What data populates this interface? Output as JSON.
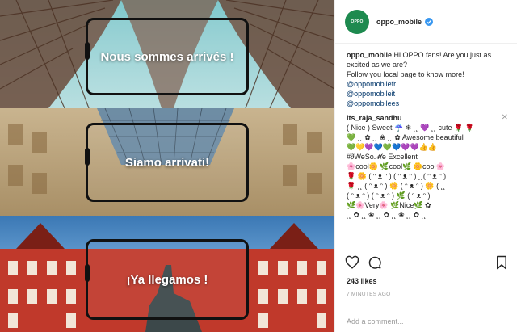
{
  "photo": {
    "panels": [
      {
        "caption": "Nous sommes arrivés !"
      },
      {
        "caption": "Siamo arrivati!"
      },
      {
        "caption": "¡Ya llegamos !"
      }
    ]
  },
  "post": {
    "avatar_text": "OPPO",
    "username": "oppo_mobile",
    "caption_user": "oppo_mobile",
    "caption_text": "Hi OPPO fans! Are you just as excited as we are?",
    "caption_line2": "Follow you local page to know more!",
    "mentions": [
      "@oppomobilefr",
      "@oppomobileit",
      "@oppomobilees"
    ],
    "comment_user": "its_raja_sandhu",
    "comment_lines": [
      "( Nice ) Sweet ☔ ❄ ˛˛ 💜 ˛˛ cute 🌹 🌹",
      "💚 ˛˛ ✿ ˛˛ ❀ ˛˛ ✿ Awesome beautiful",
      "💚💛💜💙💚💙💜💜👍👍",
      "#∂WeSo𝓜e Excellent",
      "🌸cool🌼 🌿cool🌿 🌼cool🌸",
      "🌹 🌼 ( ᵔ ᴥ ᵔ ) ( ᵔ ᴥ ᵔ ) ˛˛( ᵔ ᴥ ᵔ )",
      "🌹 ˛˛ ( ᵔ ᴥ ᵔ ) 🌼 ( ᵔ ᴥ ᵔ ) 🌼 ( ˛˛",
      "( ᵔ ᴥ ᵔ ) ( ᵔ ᴥ ᵔ ) 🌿 ( ᵔ ᴥ ᵔ )",
      "🌿🌸Very🌸 🌿Nice🌿 ✿",
      "˛˛ ✿ ˛˛ ❀ ˛˛ ✿ ˛˛ ❀ ˛˛ ✿ ˛˛"
    ],
    "close_symbol": "✕",
    "likes": "243 likes",
    "time_ago": "7 MINUTES AGO",
    "comment_placeholder": "Add a comment..."
  },
  "colors": {
    "link": "#003569",
    "verified": "#3897f0",
    "avatar_bg": "#1e8a4f"
  },
  "icons": [
    "heart-icon",
    "comment-icon",
    "bookmark-icon",
    "verified-icon",
    "close-icon"
  ]
}
